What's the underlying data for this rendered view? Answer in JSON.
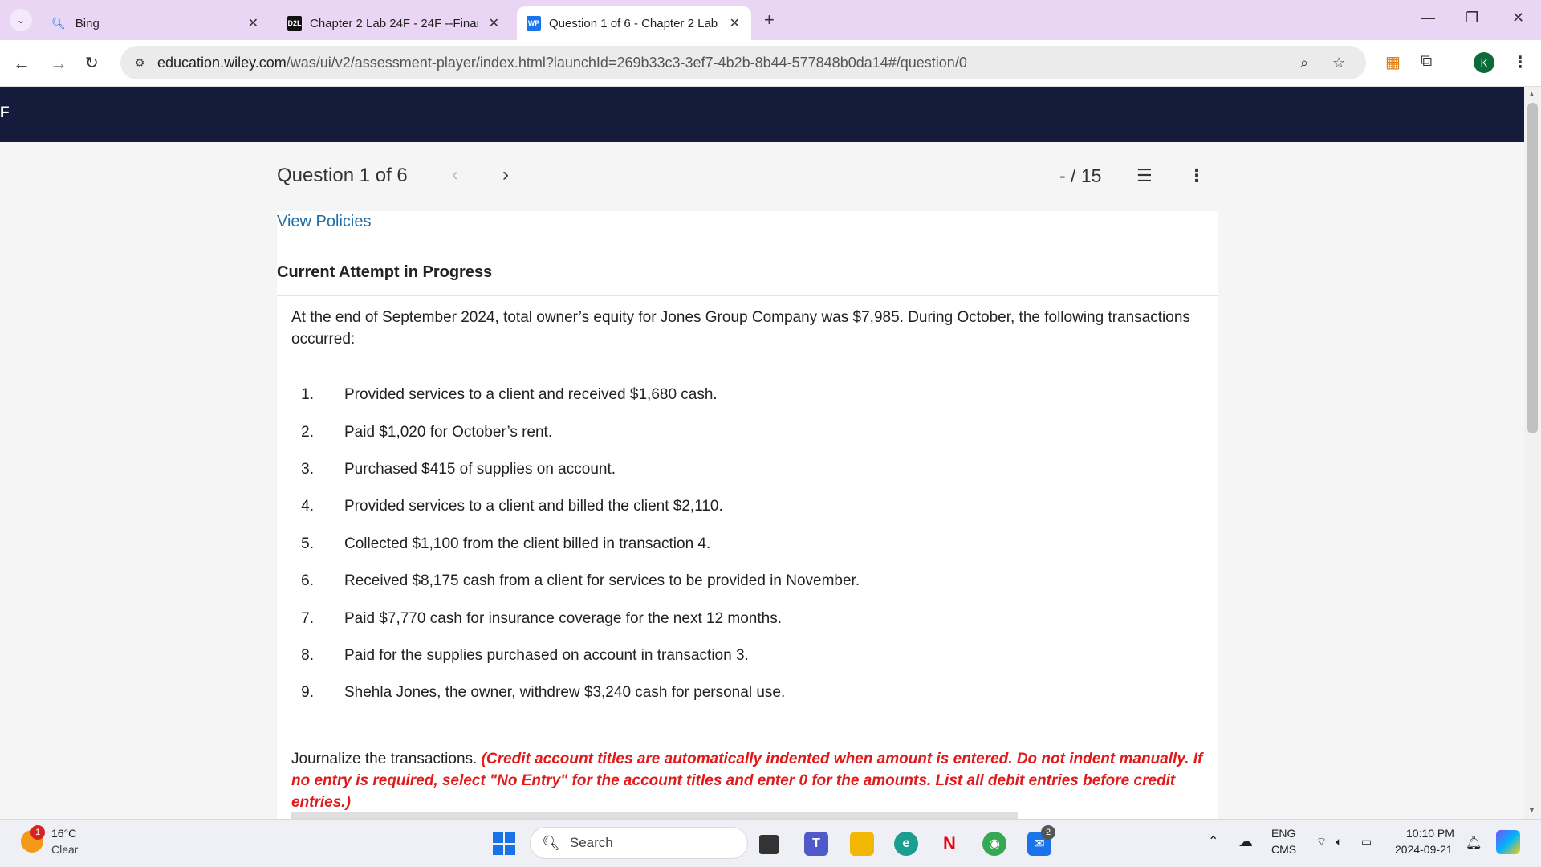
{
  "browser": {
    "tabs": [
      {
        "title": "Bing",
        "icon": "search-icon"
      },
      {
        "title": "Chapter 2 Lab 24F - 24F --Finan",
        "icon": "D2L",
        "icon_color": "#111111"
      },
      {
        "title": "Question 1 of 6 - Chapter 2 Lab",
        "icon": "WP",
        "icon_color": "#1a73e8",
        "active": true
      }
    ],
    "url_domain": "education.wiley.com",
    "url_path": "/was/ui/v2/assessment-player/index.html?launchId=269b33c3-3ef7-4b2b-8b44-577848b0da14#/question/0",
    "avatar_letter": "K"
  },
  "header": {
    "letter": "F",
    "color": "#141b3b"
  },
  "question_nav": {
    "label": "Question 1 of 6",
    "score": "- / 15"
  },
  "content": {
    "view_policies": "View Policies",
    "attempt_label": "Current Attempt in Progress",
    "intro": "At the end of September 2024, total owner’s equity for Jones Group Company was $7,985. During October, the following transactions occurred:",
    "transactions": [
      {
        "num": "1.",
        "text": "Provided services to a client and received $1,680 cash."
      },
      {
        "num": "2.",
        "text": "Paid $1,020 for October’s rent."
      },
      {
        "num": "3.",
        "text": "Purchased $415 of supplies on account."
      },
      {
        "num": "4.",
        "text": "Provided services to a client and billed the client $2,110."
      },
      {
        "num": "5.",
        "text": "Collected $1,100 from the client billed in transaction 4."
      },
      {
        "num": "6.",
        "text": "Received $8,175 cash from a client for services to be provided in November."
      },
      {
        "num": "7.",
        "text": "Paid $7,770 cash for insurance coverage for the next 12 months."
      },
      {
        "num": "8.",
        "text": "Paid for the supplies purchased on account in transaction 3."
      },
      {
        "num": "9.",
        "text": "Shehla Jones, the owner, withdrew $3,240 cash for personal use."
      }
    ],
    "instruction_lead": "Journalize the transactions.",
    "instruction_red": "(Credit account titles are automatically indented when amount is entered. Do not indent manually. If no entry is required, select \"No Entry\" for the account titles and enter 0 for the amounts. List all debit entries before credit entries.)",
    "accent_red": "#e01a1a",
    "link_color": "#1f6ea8"
  },
  "taskbar": {
    "weather_temp": "16°C",
    "weather_condition": "Clear",
    "weather_badge": "1",
    "search_label": "Search",
    "lang_top": "ENG",
    "lang_bottom": "CMS",
    "time": "10:10 PM",
    "date": "2024-09-21",
    "mail_badge": "2"
  }
}
